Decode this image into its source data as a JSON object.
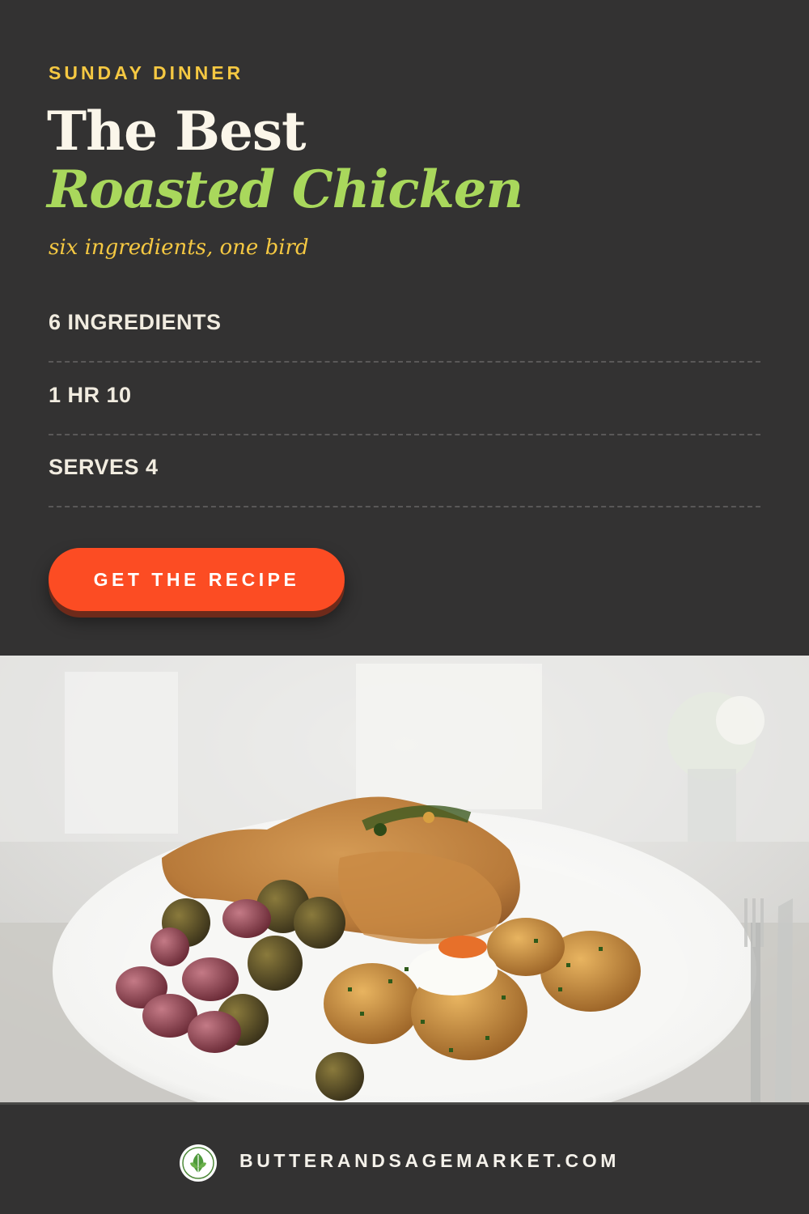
{
  "eyebrow": "SUNDAY DINNER",
  "title": {
    "line1": "The Best",
    "line2": "Roasted Chicken"
  },
  "tagline": "six ingredients, one bird",
  "stats": [
    {
      "label": "6 INGREDIENTS"
    },
    {
      "label": "1 HR 10"
    },
    {
      "label": "SERVES 4"
    }
  ],
  "cta": {
    "label": "GET THE RECIPE"
  },
  "photo": {
    "icon": "roasted-chicken-plate-photo"
  },
  "footer": {
    "logo_icon": "sage-leaf-logo-icon",
    "site": "BUTTERANDSAGEMARKET.COM"
  },
  "colors": {
    "background": "#333232",
    "eyebrow": "#f5c842",
    "title_primary": "#fbf6ea",
    "title_accent": "#a9d85c",
    "tagline": "#f5c842",
    "cta": "#fc4c23"
  }
}
